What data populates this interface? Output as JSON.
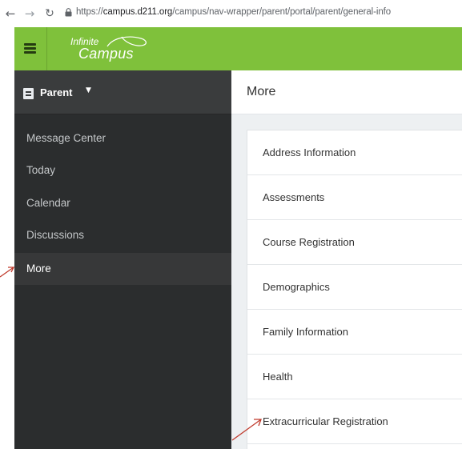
{
  "browser": {
    "url_prefix": "https://",
    "url_domain": "campus.d211.org",
    "url_path": "/campus/nav-wrapper/parent/portal/parent/general-info",
    "back_icon": "arrow-left-icon",
    "forward_icon": "arrow-right-icon",
    "reload_icon": "reload-icon",
    "lock_icon": "lock-icon"
  },
  "header": {
    "menu_icon": "hamburger-icon",
    "logo_line1": "Infinite",
    "logo_line2": "Campus",
    "color": "#7fc13b"
  },
  "sidebar": {
    "role_label": "Parent",
    "role_icon": "id-card-icon",
    "role_caret": "▼",
    "items": [
      {
        "label": "Message Center"
      },
      {
        "label": "Today"
      },
      {
        "label": "Calendar"
      },
      {
        "label": "Discussions"
      },
      {
        "label": "More",
        "active": true
      }
    ]
  },
  "main": {
    "title": "More",
    "items": [
      {
        "label": "Address Information"
      },
      {
        "label": "Assessments"
      },
      {
        "label": "Course Registration"
      },
      {
        "label": "Demographics"
      },
      {
        "label": "Family Information"
      },
      {
        "label": "Health"
      },
      {
        "label": "Extracurricular Registration"
      }
    ]
  },
  "annotations": {
    "arrow_color": "#c0392b"
  }
}
